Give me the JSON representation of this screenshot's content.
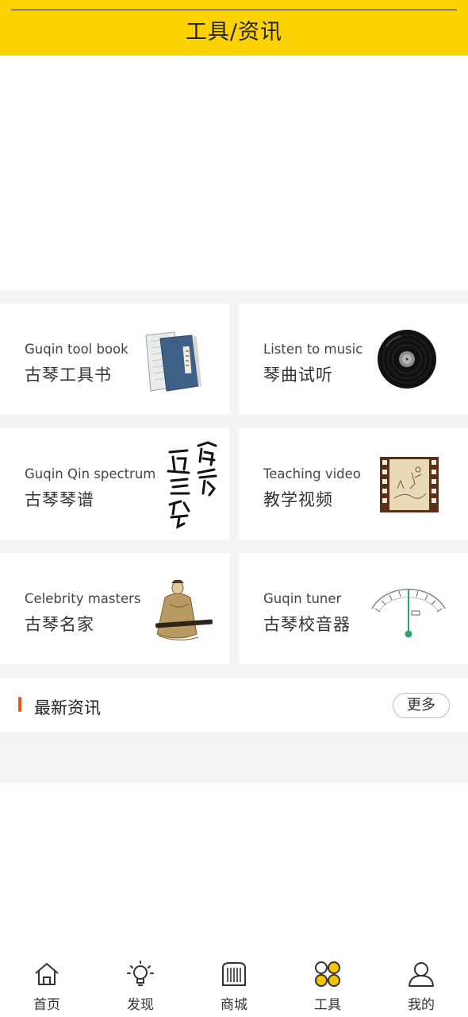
{
  "header": {
    "title": "工具/资讯"
  },
  "tools": [
    {
      "en": "Guqin tool book",
      "zh": "古琴工具书",
      "icon": "book-icon"
    },
    {
      "en": "Listen to music",
      "zh": "琴曲试听",
      "icon": "vinyl-record-icon"
    },
    {
      "en": "Guqin Qin spectrum",
      "zh": "古琴琴谱",
      "icon": "calligraphy-icon"
    },
    {
      "en": "Teaching video",
      "zh": "教学视频",
      "icon": "film-strip-icon"
    },
    {
      "en": "Celebrity masters",
      "zh": "古琴名家",
      "icon": "master-figure-icon"
    },
    {
      "en": "Guqin tuner",
      "zh": "古琴校音器",
      "icon": "tuner-gauge-icon"
    }
  ],
  "news": {
    "title": "最新资讯",
    "more_label": "更多"
  },
  "tabbar": {
    "items": [
      {
        "label": "首页",
        "icon": "home-icon"
      },
      {
        "label": "发现",
        "icon": "lightbulb-icon"
      },
      {
        "label": "商城",
        "icon": "store-icon"
      },
      {
        "label": "工具",
        "icon": "tools-grid-icon",
        "active": true
      },
      {
        "label": "我的",
        "icon": "profile-icon"
      }
    ]
  },
  "colors": {
    "accent": "#fcd300",
    "news_bar": "#e8590f",
    "active_dots": "#f5c400"
  }
}
